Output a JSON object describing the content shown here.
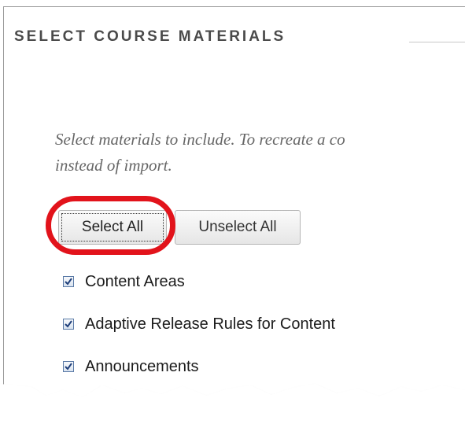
{
  "header_fragment": "",
  "section": {
    "title": "SELECT COURSE MATERIALS"
  },
  "instructions": {
    "line1": "Select materials to include. To recreate a co",
    "line2": "instead of import."
  },
  "buttons": {
    "select_all": "Select All",
    "unselect_all": "Unselect All"
  },
  "highlight": {
    "color": "#e2131b",
    "target": "select-all-button"
  },
  "materials": [
    {
      "label": "Content Areas",
      "checked": true
    },
    {
      "label": "Adaptive Release Rules for Content",
      "checked": true
    },
    {
      "label": "Announcements",
      "checked": true
    }
  ],
  "colors": {
    "title": "#4a4a4a",
    "instructions": "#666666",
    "checkbox_border": "#5a7aa6",
    "check_mark": "#1f3f7a"
  }
}
